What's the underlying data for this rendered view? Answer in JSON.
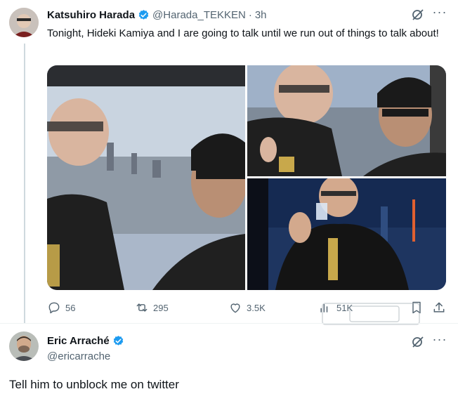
{
  "tweet": {
    "author_name": "Katsuhiro Harada",
    "author_handle": "@Harada_TEKKEN",
    "separator": "·",
    "time": "3h",
    "text": "Tonight, Hideki Kamiya and I are going to talk until we run out of things to talk about!",
    "actions": {
      "replies": "56",
      "reposts": "295",
      "likes": "3.5K",
      "views": "51K"
    }
  },
  "reply": {
    "author_name": "Eric Arraché",
    "author_handle": "@ericarrache",
    "text": "Tell him to unblock me on twitter"
  },
  "icons": {
    "verified": "verified-badge-icon",
    "grok": "grok-icon",
    "more": "more-icon",
    "reply": "reply-icon",
    "repost": "repost-icon",
    "like": "heart-icon",
    "views": "views-icon",
    "bookmark": "bookmark-icon",
    "share": "share-icon"
  },
  "colors": {
    "verified_blue": "#1d9bf0",
    "muted": "#536471",
    "text": "#0f1419"
  }
}
